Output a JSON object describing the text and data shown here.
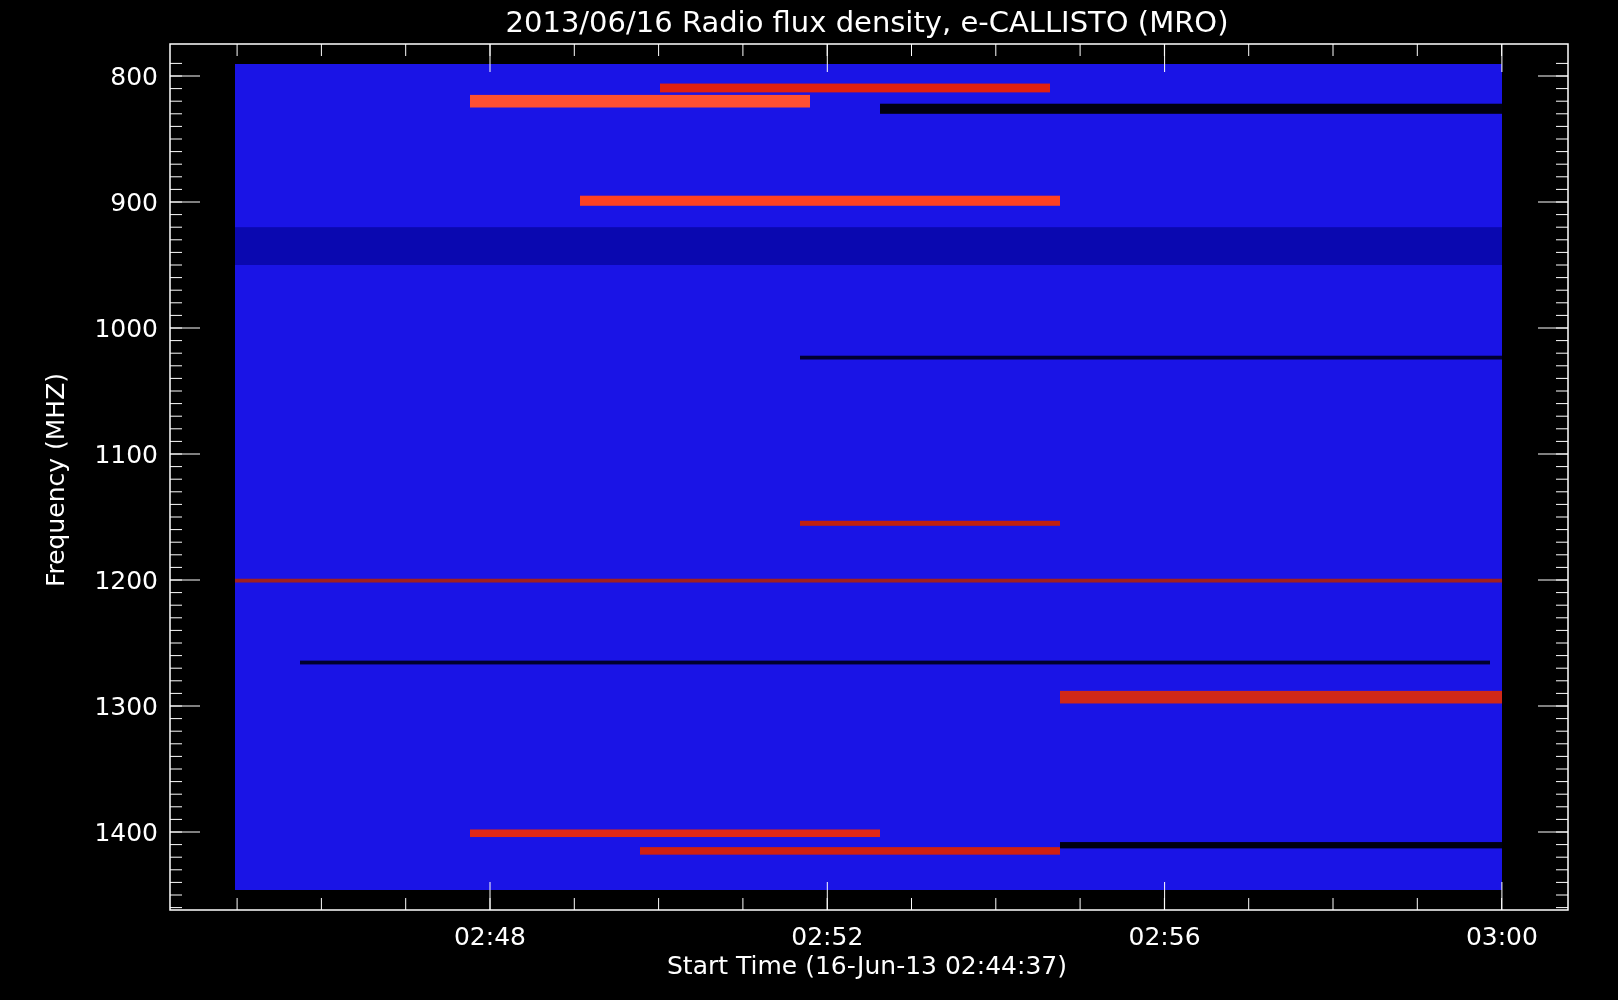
{
  "title": "2013/06/16  Radio flux density, e-CALLISTO (MRO)",
  "ylabel": "Frequency (MHZ)",
  "xlabel": "Start Time (16-Jun-13 02:44:37)",
  "yticks": [
    "800",
    "900",
    "1000",
    "1100",
    "1200",
    "1300",
    "1400"
  ],
  "xticks": [
    "02:48",
    "02:52",
    "02:56",
    "03:00"
  ]
}
